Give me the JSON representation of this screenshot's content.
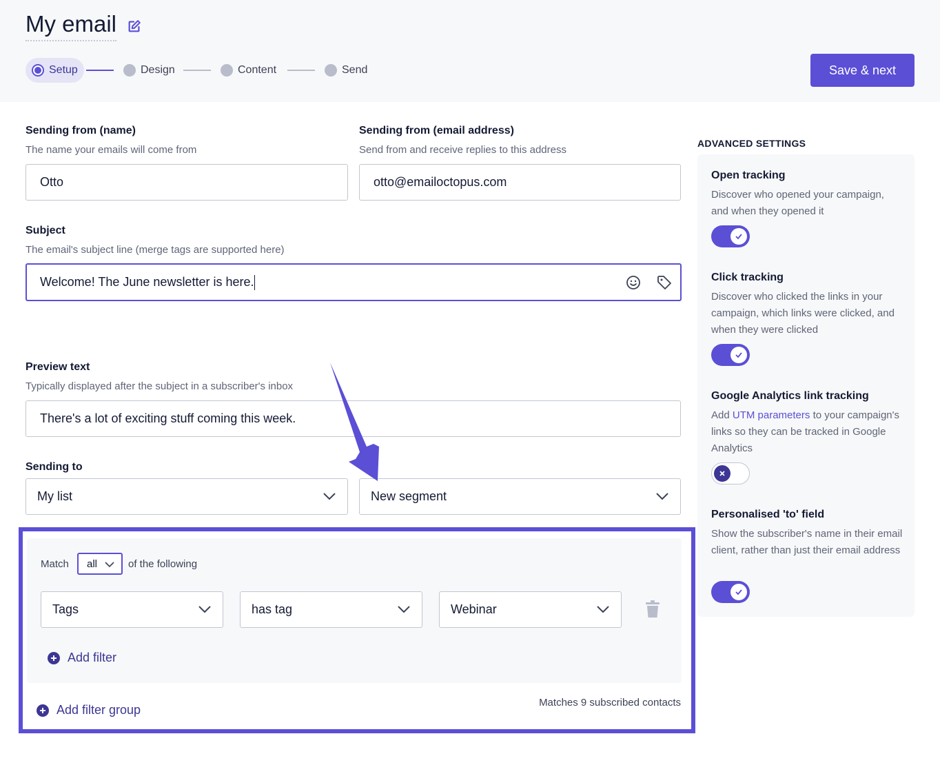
{
  "header": {
    "title": "My email",
    "steps": [
      {
        "label": "Setup",
        "active": true
      },
      {
        "label": "Design",
        "active": false
      },
      {
        "label": "Content",
        "active": false
      },
      {
        "label": "Send",
        "active": false
      }
    ],
    "save_label": "Save & next"
  },
  "form": {
    "from_name": {
      "label": "Sending from (name)",
      "hint": "The name your emails will come from",
      "value": "Otto"
    },
    "from_email": {
      "label": "Sending from (email address)",
      "hint": "Send from and receive replies to this address",
      "value": "otto@emailoctopus.com"
    },
    "subject": {
      "label": "Subject",
      "hint": "The email's subject line (merge tags are supported here)",
      "value": "Welcome! The June newsletter is here."
    },
    "preview": {
      "label": "Preview text",
      "hint": "Typically displayed after the subject in a subscriber's inbox",
      "value": "There's a lot of exciting stuff coming this week."
    },
    "sending_to": {
      "label": "Sending to",
      "list_value": "My list",
      "segment_value": "New segment"
    }
  },
  "segment": {
    "match_prefix": "Match",
    "match_value": "all",
    "match_suffix": "of the following",
    "filter": {
      "field": "Tags",
      "operator": "has tag",
      "value": "Webinar"
    },
    "add_filter_label": "Add filter",
    "add_group_label": "Add filter group",
    "matches_text": "Matches 9 subscribed contacts"
  },
  "advanced": {
    "title": "ADVANCED SETTINGS",
    "open_tracking": {
      "title": "Open tracking",
      "desc": "Discover who opened your campaign, and when they opened it",
      "enabled": true
    },
    "click_tracking": {
      "title": "Click tracking",
      "desc": "Discover who clicked the links in your campaign, which links were clicked, and when they were clicked",
      "enabled": true
    },
    "ga_tracking": {
      "title": "Google Analytics link tracking",
      "desc_prefix": "Add",
      "desc_link": "UTM parameters",
      "desc_suffix": "to your campaign's links so they can be tracked in Google Analytics",
      "enabled": false
    },
    "personalised_to": {
      "title": "Personalised 'to' field",
      "desc": "Show the subscriber's name in their email client, rather than just their email address",
      "enabled": true
    }
  },
  "colors": {
    "accent": "#5b4fd6",
    "accent_dark": "#3d3694",
    "panel_bg": "#f7f8f9"
  }
}
